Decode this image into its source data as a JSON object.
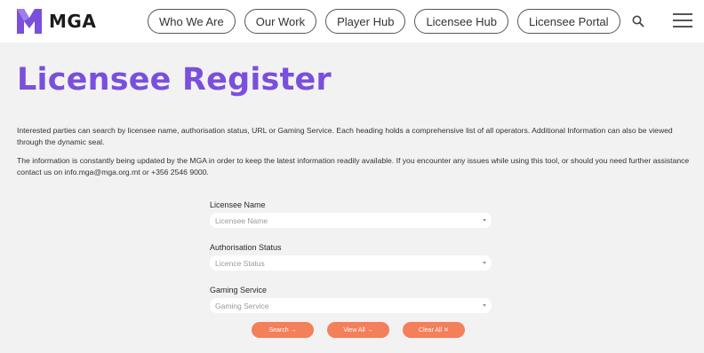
{
  "header": {
    "logo_text": "MGA",
    "brand_color": "#7a4fdc",
    "nav": [
      {
        "label": "Who We Are"
      },
      {
        "label": "Our Work"
      },
      {
        "label": "Player Hub"
      },
      {
        "label": "Licensee Hub"
      },
      {
        "label": "Licensee Portal"
      }
    ],
    "search_icon": "search-icon",
    "menu_icon": "hamburger-menu-icon"
  },
  "main": {
    "title": "Licensee Register",
    "paragraph1": "Interested parties can search by licensee name, authorisation status, URL or Gaming Service. Each heading holds a comprehensive list of all operators. Additional Information can also be viewed through the dynamic seal.",
    "paragraph2": "The information is constantly being updated by the MGA in order to keep the latest information readily available. If you encounter any issues while using this tool, or should you need further assistance contact us on info.mga@mga.org.mt or +356 2546 9000."
  },
  "form": {
    "fields": [
      {
        "label": "Licensee Name",
        "placeholder": "Licensee Name"
      },
      {
        "label": "Authorisation Status",
        "placeholder": "Licence Status"
      },
      {
        "label": "Gaming Service",
        "placeholder": "Gaming Service"
      }
    ],
    "buttons": {
      "search": "Search →",
      "view_all": "View All →",
      "clear_all": "Clear All ✕"
    },
    "button_color": "#f47f5b"
  }
}
